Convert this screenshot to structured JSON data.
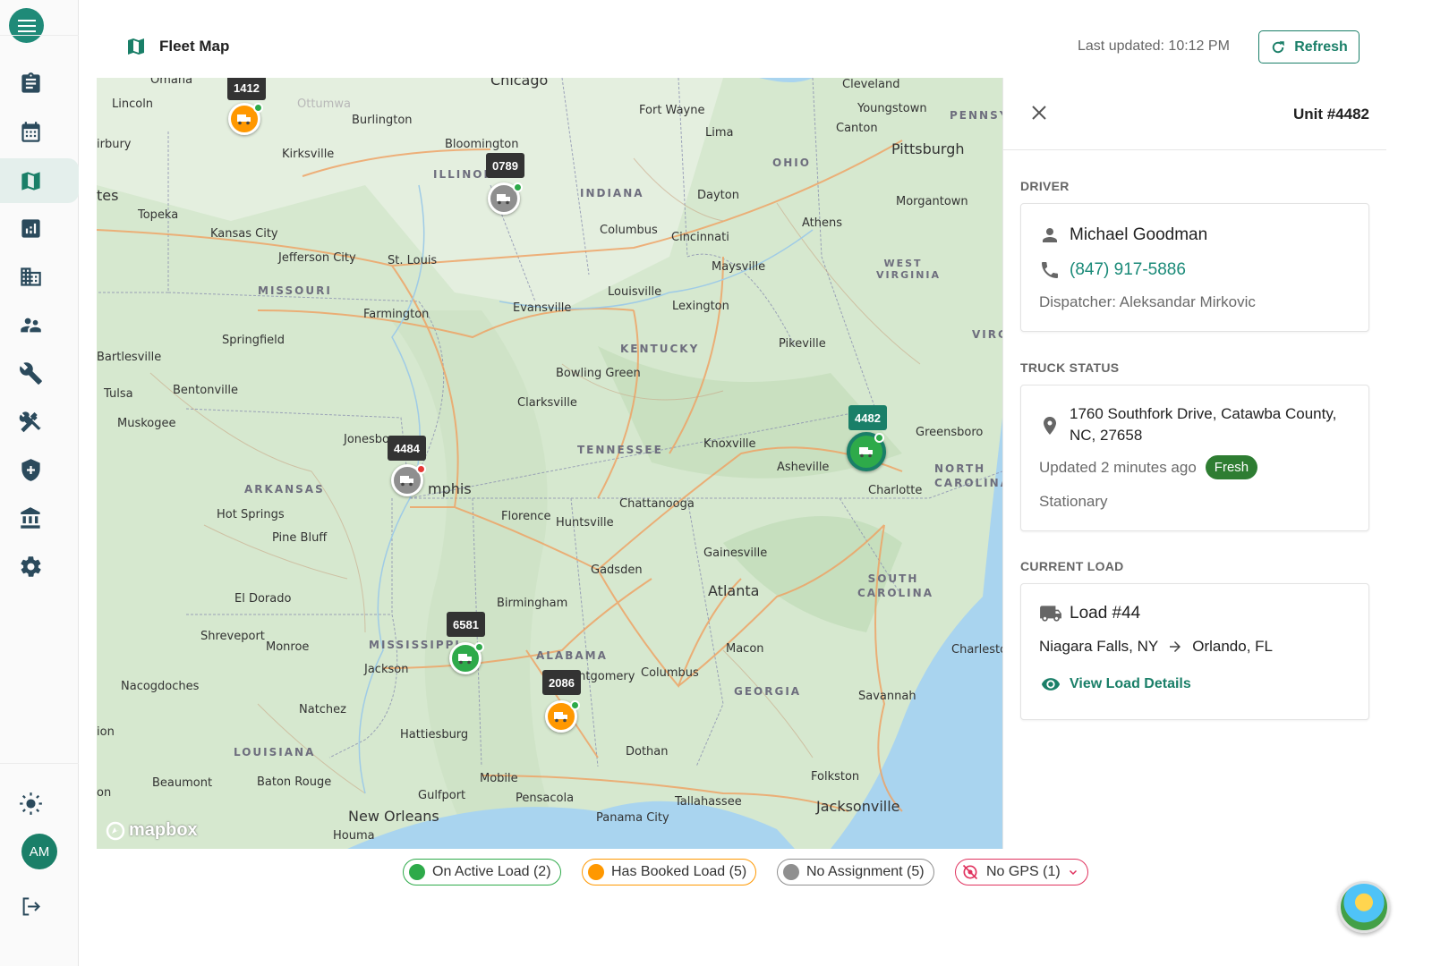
{
  "app": {
    "title": "Fleet Map",
    "last_updated": "Last updated: 10:12 PM",
    "refresh_label": "Refresh"
  },
  "user": {
    "initials": "AM"
  },
  "sidebar": {
    "items": [
      {
        "icon": "clipboard-icon",
        "active": false
      },
      {
        "icon": "calendar-icon",
        "active": false
      },
      {
        "icon": "map-icon",
        "active": true
      },
      {
        "icon": "chart-icon",
        "active": false
      },
      {
        "icon": "building-icon",
        "active": false
      },
      {
        "icon": "people-icon",
        "active": false
      },
      {
        "icon": "wrench-icon",
        "active": false
      },
      {
        "icon": "tools-icon",
        "active": false
      },
      {
        "icon": "shield-icon",
        "active": false
      },
      {
        "icon": "bank-icon",
        "active": false
      },
      {
        "icon": "gear-icon",
        "active": false
      }
    ]
  },
  "map": {
    "attribution": "mapbox",
    "labels": [
      "Omaha",
      "Chicago",
      "Cleveland",
      "Lincoln",
      "Burlington",
      "Fort Wayne",
      "Youngstown",
      "PENNSY",
      "Ottumwa",
      "Lima",
      "Canton",
      "Bloomington",
      "Pittsburgh",
      "Kirksville",
      "ILLINOIS",
      "OHIO",
      "irbury",
      "INDIANA",
      "Dayton",
      "tes",
      "Topeka",
      "Kansas City",
      "Columbus",
      "Cincinnati",
      "Athens",
      "Morgantown",
      "Jefferson City",
      "St. Louis",
      "Maysville",
      "WEST VIRGINIA",
      "MISSOURI",
      "Louisville",
      "Lexington",
      "Farmington",
      "Evansville",
      "VIRG",
      "Springfield",
      "KENTUCKY",
      "Pikeville",
      "Bartlesville",
      "Bowling Green",
      "Tulsa",
      "Bentonville",
      "Clarksville",
      "Muskogee",
      "Jonesboro",
      "TENNESSEE",
      "Knoxville",
      "Greensboro",
      "Asheville",
      "NORTH CAROLINA",
      "mphis",
      "ARKANSAS",
      "Charlotte",
      "Hot Springs",
      "Florence",
      "Huntsville",
      "Chattanooga",
      "Pine Bluff",
      "Gainesville",
      "Gadsden",
      "SOUTH CAROLINA",
      "El Dorado",
      "Atlanta",
      "Birmingham",
      "Shreveport",
      "Monroe",
      "MISSISSIPPI",
      "ALABAMA",
      "Macon",
      "Charleston",
      "Jackson",
      "Montgomery",
      "Columbus",
      "Nacogdoches",
      "GEORGIA",
      "Savannah",
      "Natchez",
      "ion",
      "Hattiesburg",
      "Dothan",
      "LOUISIANA",
      "Mobile",
      "Beaumont",
      "Baton Rouge",
      "Folkston",
      "on",
      "Gulfport",
      "Pensacola",
      "Tallahassee",
      "Jacksonville",
      "New Orleans",
      "Panama City",
      "Houma"
    ],
    "markers": [
      {
        "unit": "1412",
        "status": "booked",
        "gps": "online"
      },
      {
        "unit": "0789",
        "status": "none",
        "gps": "online"
      },
      {
        "unit": "4484",
        "status": "none",
        "gps": "offline"
      },
      {
        "unit": "4482",
        "status": "active",
        "gps": "online",
        "selected": true
      },
      {
        "unit": "6581",
        "status": "active",
        "gps": "online"
      },
      {
        "unit": "2086",
        "status": "booked",
        "gps": "online"
      }
    ]
  },
  "panel": {
    "unit_title": "Unit #4482",
    "driver_label": "DRIVER",
    "driver_name": "Michael Goodman",
    "driver_phone": "(847) 917-5886",
    "dispatcher": "Dispatcher: Aleksandar Mirkovic",
    "truck_status_label": "TRUCK STATUS",
    "address": "1760 Southfork Drive, Catawba County, NC, 27658",
    "updated": "Updated 2 minutes ago",
    "fresh_badge": "Fresh",
    "motion": "Stationary",
    "current_load_label": "CURRENT LOAD",
    "load_title": "Load #44",
    "origin": "Niagara Falls, NY",
    "destination": "Orlando, FL",
    "view_details": "View Load Details"
  },
  "legend": [
    {
      "label": "On Active Load (2)",
      "color": "#2eaa4a"
    },
    {
      "label": "Has Booked Load (5)",
      "color": "#ff9800"
    },
    {
      "label": "No Assignment (5)",
      "color": "#8f8f8f"
    },
    {
      "label": "No GPS (1)",
      "color": "#e0325e"
    }
  ],
  "colors": {
    "brand": "#1a7f68",
    "active": "#2eaa4a",
    "booked": "#ff9800",
    "none": "#8f8f8f",
    "nogps": "#e0325e"
  }
}
